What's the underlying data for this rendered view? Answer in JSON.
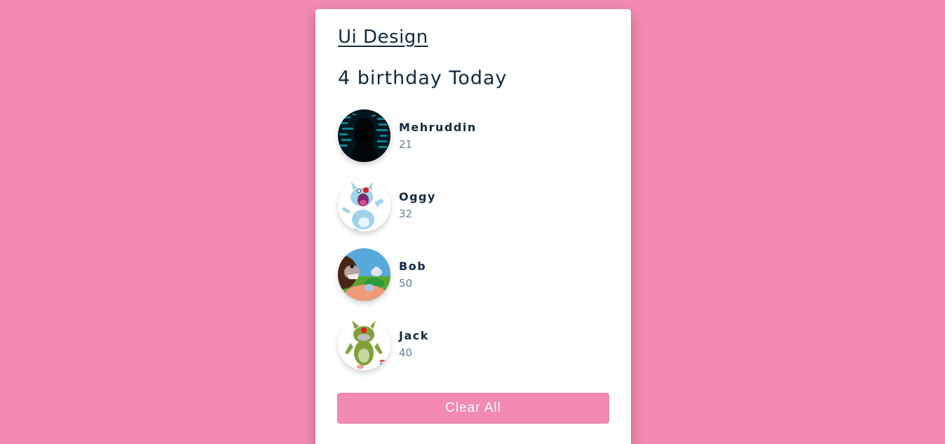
{
  "app": {
    "title": "Ui Design",
    "heading": "4 birthday Today"
  },
  "people": [
    {
      "name": "Mehruddin",
      "age": "21",
      "avatar_icon": "hooded-hacker-avatar"
    },
    {
      "name": "Oggy",
      "age": "32",
      "avatar_icon": "blue-cat-cartoon-avatar"
    },
    {
      "name": "Bob",
      "age": "50",
      "avatar_icon": "bulldog-cartoon-avatar"
    },
    {
      "name": "Jack",
      "age": "40",
      "avatar_icon": "green-cat-cartoon-avatar"
    }
  ],
  "actions": {
    "clear_all_label": "Clear All"
  },
  "colors": {
    "background": "#f28ab2",
    "card": "#ffffff",
    "text_primary": "#102a42",
    "text_secondary": "#617d98",
    "button": "#f28ab2"
  }
}
